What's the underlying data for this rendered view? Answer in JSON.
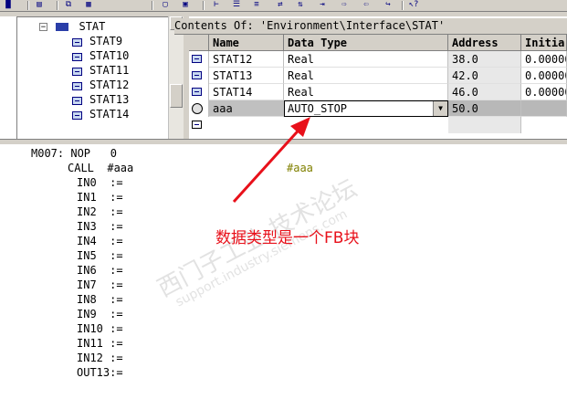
{
  "toolbar": {
    "icons": [
      "save-icon",
      "print-icon",
      "copy-icon",
      "paste-icon",
      "insert-row-icon",
      "tree-icon",
      "list-icon",
      "window-icon",
      "context-help-icon"
    ]
  },
  "contents_path": "Contents Of: 'Environment\\Interface\\STAT'",
  "tree": {
    "root_label": "STAT",
    "items": [
      "STAT9",
      "STAT10",
      "STAT11",
      "STAT12",
      "STAT13",
      "STAT14"
    ]
  },
  "grid": {
    "columns": [
      "Name",
      "Data Type",
      "Address",
      "Initia"
    ],
    "rows": [
      {
        "name": "STAT12",
        "type": "Real",
        "address": "38.0",
        "initial": "0.00000"
      },
      {
        "name": "STAT13",
        "type": "Real",
        "address": "42.0",
        "initial": "0.00000"
      },
      {
        "name": "STAT14",
        "type": "Real",
        "address": "46.0",
        "initial": "0.00000"
      },
      {
        "name": "aaa",
        "type": "AUTO_STOP",
        "address": "50.0",
        "initial": ""
      }
    ]
  },
  "code": {
    "network": "M007: NOP   0",
    "call": "CALL  #aaa",
    "call_comment": "#aaa",
    "params": [
      "IN0  :=",
      "IN1  :=",
      "IN2  :=",
      "IN3  :=",
      "IN4  :=",
      "IN5  :=",
      "IN6  :=",
      "IN7  :=",
      "IN8  :=",
      "IN9  :=",
      "IN10 :=",
      "IN11 :=",
      "IN12 :=",
      "OUT13:="
    ]
  },
  "annotation": "数据类型是一个FB块",
  "watermark": {
    "line1": "西门子工业  技术论坛",
    "line2": "support.industry.siemens.com"
  },
  "colors": {
    "annotation": "#e8101a",
    "selection": "#c0c0c0",
    "panel": "#d4d0c8"
  }
}
